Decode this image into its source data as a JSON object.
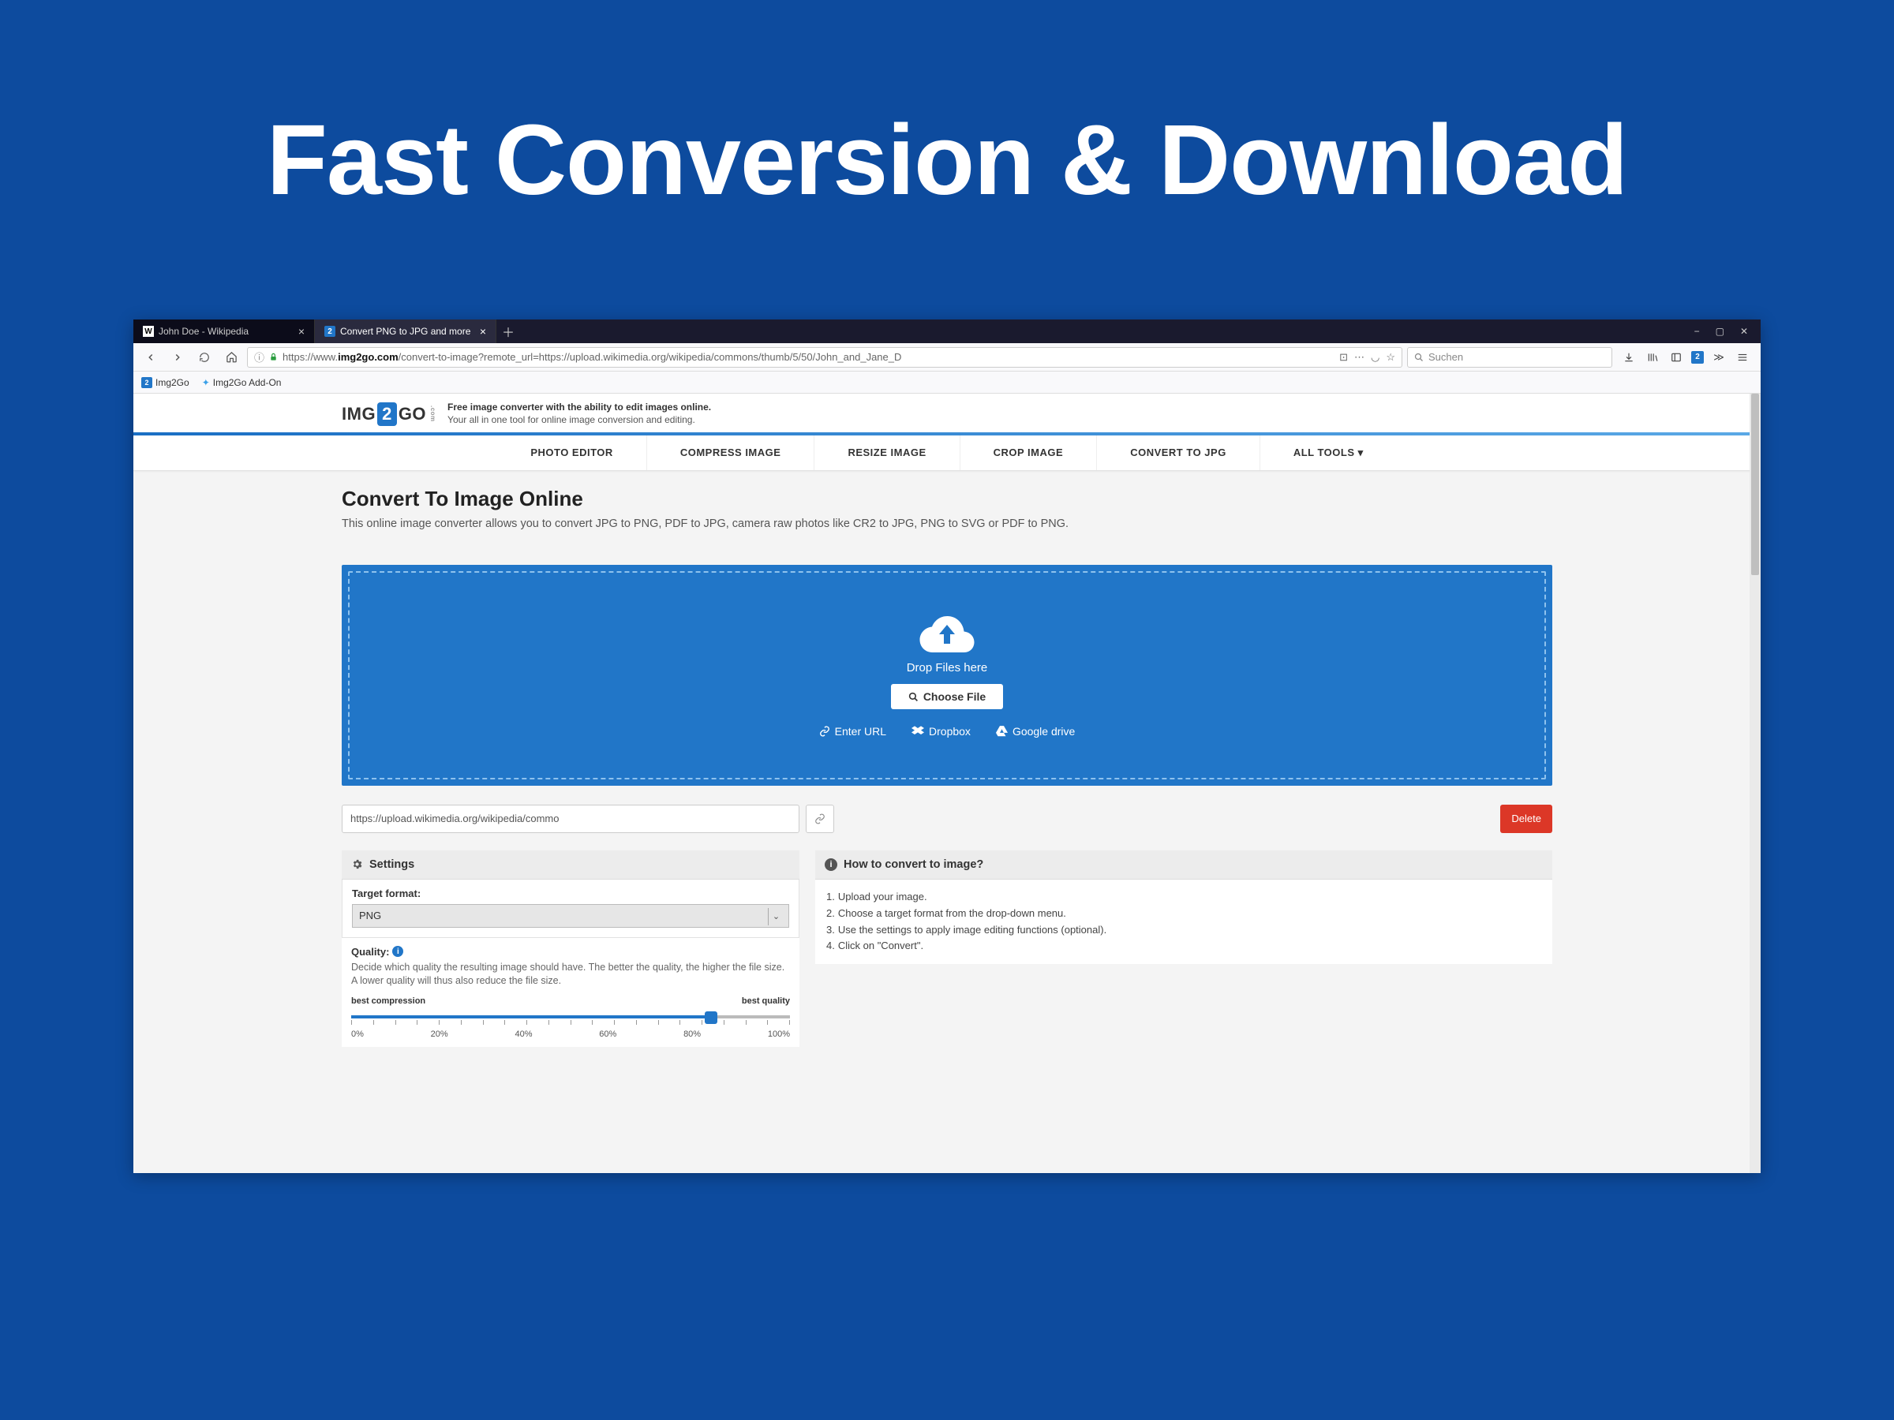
{
  "headline": "Fast Conversion & Download",
  "browser": {
    "tabs": [
      {
        "title": "John Doe - Wikipedia",
        "icon": "W"
      },
      {
        "title": "Convert PNG to JPG and more",
        "icon": "2"
      }
    ],
    "window_controls": [
      "−",
      "▢",
      "✕"
    ],
    "url_prefix": "https://www.",
    "url_host": "img2go.com",
    "url_path": "/convert-to-image?remote_url=https://upload.wikimedia.org/wikipedia/commons/thumb/5/50/John_and_Jane_D",
    "search_placeholder": "Suchen",
    "bookmarks": [
      {
        "label": "Img2Go",
        "icon": "2"
      },
      {
        "label": "Img2Go Add-On",
        "icon": "✦"
      }
    ]
  },
  "logo": {
    "left": "IMG",
    "mid": "2",
    "right": "GO",
    "tag_bold": "Free image converter with the ability to edit images online.",
    "tag_sub": "Your all in one tool for online image conversion and editing."
  },
  "nav": [
    "PHOTO EDITOR",
    "COMPRESS IMAGE",
    "RESIZE IMAGE",
    "CROP IMAGE",
    "CONVERT TO JPG",
    "ALL TOOLS"
  ],
  "heading": "Convert To Image Online",
  "description": "This online image converter allows you to convert JPG to PNG, PDF to JPG, camera raw photos like CR2 to JPG, PNG to SVG or PDF to PNG.",
  "dropzone": {
    "label": "Drop Files here",
    "choose": "Choose File",
    "sources": [
      "Enter URL",
      "Dropbox",
      "Google drive"
    ]
  },
  "url_input": "https://upload.wikimedia.org/wikipedia/commo",
  "delete_label": "Delete",
  "settings": {
    "head": "Settings",
    "target_label": "Target format:",
    "target_value": "PNG",
    "quality_label": "Quality:",
    "quality_desc": "Decide which quality the resulting image should have. The better the quality, the higher the file size. A lower quality will thus also reduce the file size.",
    "left_end": "best compression",
    "right_end": "best quality",
    "ticks": [
      "0%",
      "20%",
      "40%",
      "60%",
      "80%",
      "100%"
    ]
  },
  "howto": {
    "head": "How to convert to image?",
    "steps": [
      "Upload your image.",
      "Choose a target format from the drop-down menu.",
      "Use the settings to apply image editing functions (optional).",
      "Click on \"Convert\"."
    ]
  }
}
